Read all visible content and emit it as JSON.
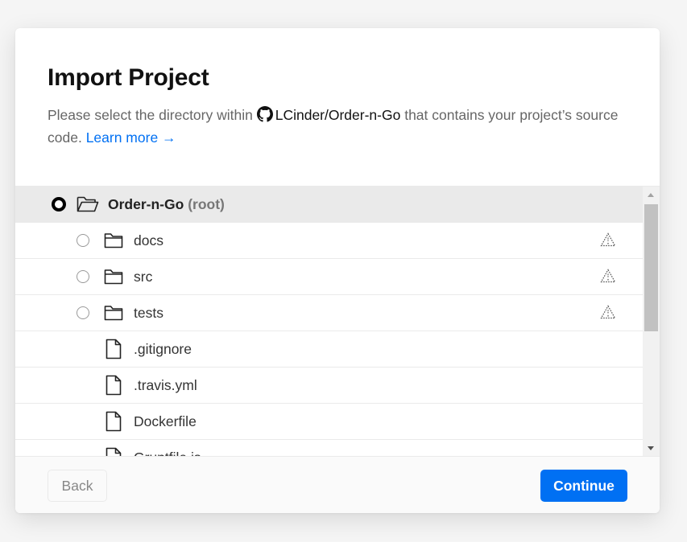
{
  "dialog": {
    "title": "Import Project",
    "description_before": "Please select the directory within ",
    "repo_name": "LCinder/Order-n-Go",
    "description_after": " that contains your project’s source code.",
    "learn_more": "Learn more →"
  },
  "tree": {
    "root": {
      "name": "Order-n-Go",
      "suffix": "(root)",
      "selected": true
    },
    "items": [
      {
        "name": "docs",
        "type": "folder",
        "icon": "folder-icon"
      },
      {
        "name": "src",
        "type": "folder",
        "icon": "folder-icon"
      },
      {
        "name": "tests",
        "type": "folder",
        "icon": "folder-icon"
      },
      {
        "name": ".gitignore",
        "type": "file",
        "icon": "file-icon"
      },
      {
        "name": ".travis.yml",
        "type": "file",
        "icon": "file-icon"
      },
      {
        "name": "Dockerfile",
        "type": "file",
        "icon": "file-icon"
      },
      {
        "name": "Gruntfile.js",
        "type": "file",
        "icon": "file-icon"
      }
    ]
  },
  "footer": {
    "back_label": "Back",
    "continue_label": "Continue"
  },
  "colors": {
    "accent": "#0070f3",
    "root_row_bg": "#eaeaea"
  }
}
